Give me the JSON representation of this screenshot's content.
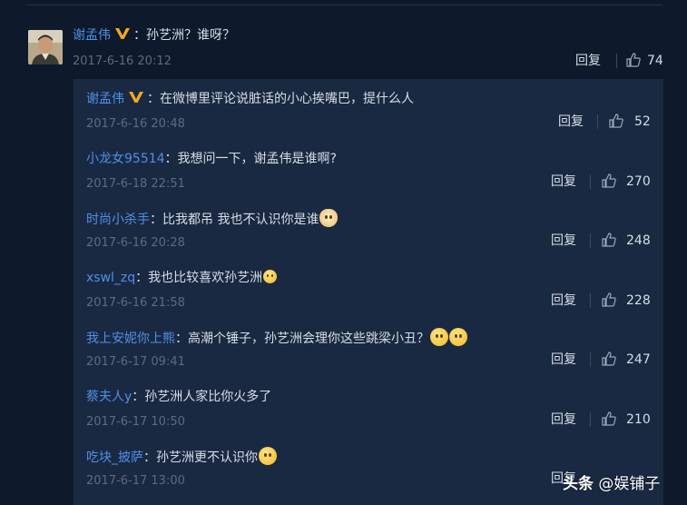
{
  "main_comment": {
    "username": "谢孟伟",
    "verified_icon": "v-verified-icon",
    "text": "孙艺洲？谁呀？",
    "time": "2017-6-16 20:12",
    "reply_label": "回复",
    "likes": "74"
  },
  "replies": [
    {
      "username": "谢孟伟",
      "verified": true,
      "text": "在微博里评论说脏话的小心挨嘴巴，提什么人",
      "emoji": "",
      "time": "2017-6-16 20:48",
      "reply_label": "回复",
      "likes": "52"
    },
    {
      "username": "小龙女95514",
      "verified": false,
      "text": "我想问一下，谢孟伟是谁啊?",
      "emoji": "",
      "time": "2017-6-18 22:51",
      "reply_label": "回复",
      "likes": "270"
    },
    {
      "username": "时尚小杀手",
      "verified": false,
      "text": "比我都吊  我也不认识你是谁",
      "emoji": "doge-emoji",
      "time": "2017-6-16 20:28",
      "reply_label": "回复",
      "likes": "248"
    },
    {
      "username": "xswl_zq",
      "verified": false,
      "text": "我也比较喜欢孙艺洲",
      "emoji": "small-face-emoji",
      "time": "2017-6-16 21:58",
      "reply_label": "回复",
      "likes": "228"
    },
    {
      "username": "我上安妮你上熊",
      "verified": false,
      "text": "高潮个锤子，孙艺洲会理你这些跳梁小丑？",
      "emoji": "smile-emoji-x2",
      "time": "2017-6-17 09:41",
      "reply_label": "回复",
      "likes": "247"
    },
    {
      "username": "蔡夫人y",
      "verified": false,
      "text": "孙艺洲人家比你火多了",
      "emoji": "",
      "time": "2017-6-17 10:50",
      "reply_label": "回复",
      "likes": "210"
    },
    {
      "username": "吃块_披萨",
      "verified": false,
      "text": "孙艺洲更不认识你",
      "emoji": "smile-emoji",
      "time": "2017-6-17 13:00",
      "reply_label": "回复",
      "likes": ""
    }
  ],
  "watermark": {
    "brand": "头条",
    "handle": "@娱铺子"
  },
  "colors": {
    "background": "#0e1a2b",
    "reply_panel": "#1a2942",
    "username": "#4f8fe8",
    "time": "#5d6b7e",
    "verified": "#f5a623"
  }
}
